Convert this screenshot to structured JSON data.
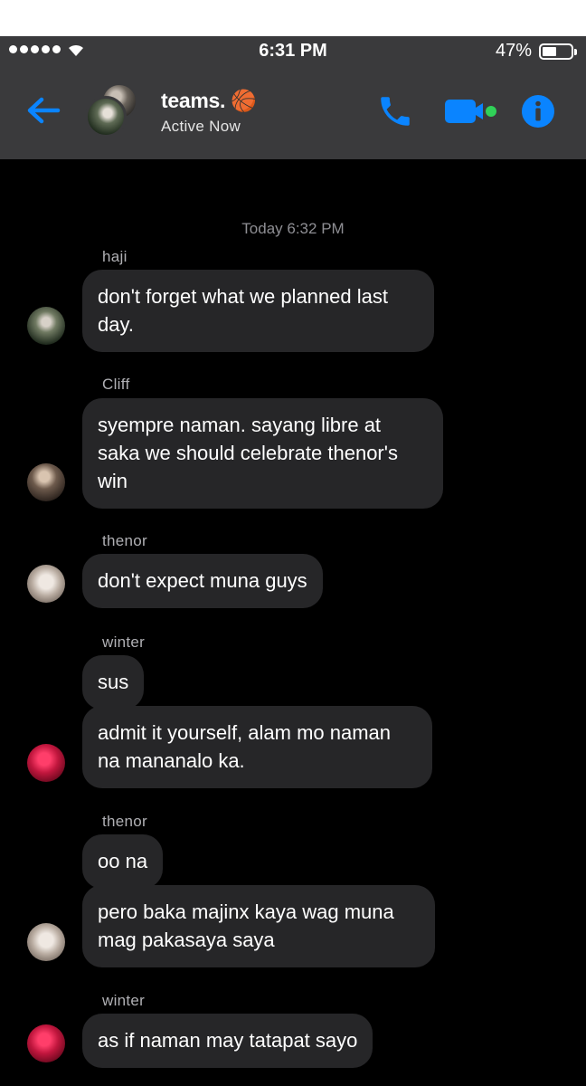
{
  "status_bar": {
    "time": "6:31 PM",
    "battery": "47%",
    "signal_icon": "signal-dots-icon",
    "wifi_icon": "wifi-icon"
  },
  "header": {
    "title": "teams. 🏀",
    "status": "Active Now",
    "back_icon": "arrow-left-icon",
    "call_icon": "phone-icon",
    "video_icon": "video-camera-icon",
    "info_icon": "info-icon",
    "accent_color": "#0a84ff",
    "online_color": "#30d158"
  },
  "conversation": {
    "timestamp": "Today 6:32 PM",
    "groups": [
      {
        "sender": "haji",
        "messages": [
          "don't forget what we planned last day."
        ]
      },
      {
        "sender": "Cliff",
        "messages": [
          "syempre naman. sayang libre at saka we should celebrate thenor's win"
        ]
      },
      {
        "sender": "thenor",
        "messages": [
          "don't expect muna guys"
        ]
      },
      {
        "sender": "winter",
        "messages": [
          "sus",
          "admit it yourself, alam mo naman na mananalo ka."
        ]
      },
      {
        "sender": "thenor",
        "messages": [
          "oo na",
          "pero baka majinx kaya wag muna mag pakasaya saya"
        ]
      },
      {
        "sender": "winter",
        "messages": [
          "as if naman may tatapat sayo"
        ]
      }
    ]
  }
}
